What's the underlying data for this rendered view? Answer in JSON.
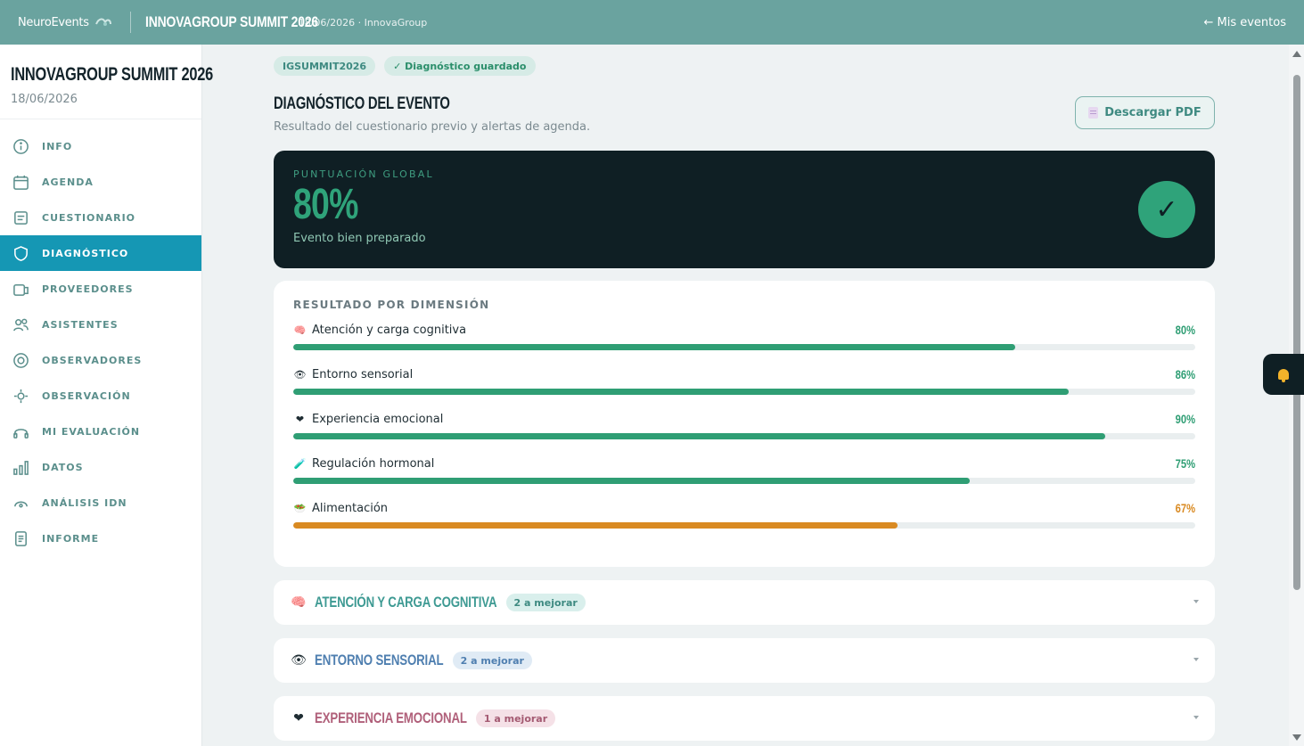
{
  "topbar": {
    "brand": "NeuroEvents",
    "event_title": "INNOVAGROUP SUMMIT 2026",
    "event_meta": "18/06/2026 · InnovaGroup",
    "back_link": "← Mis eventos"
  },
  "sidebar": {
    "title": "INNOVAGROUP SUMMIT 2026",
    "date": "18/06/2026",
    "items": [
      {
        "label": "INFO",
        "icon": "info-icon",
        "active": false
      },
      {
        "label": "AGENDA",
        "icon": "calendar-icon",
        "active": false
      },
      {
        "label": "CUESTIONARIO",
        "icon": "form-icon",
        "active": false
      },
      {
        "label": "DIAGNÓSTICO",
        "icon": "shield-icon",
        "active": true
      },
      {
        "label": "PROVEEDORES",
        "icon": "cards-icon",
        "active": false
      },
      {
        "label": "ASISTENTES",
        "icon": "users-icon",
        "active": false
      },
      {
        "label": "OBSERVADORES",
        "icon": "target-icon",
        "active": false
      },
      {
        "label": "OBSERVACIÓN",
        "icon": "crosshair-icon",
        "active": false
      },
      {
        "label": "MI EVALUACIÓN",
        "icon": "headphones-icon",
        "active": false
      },
      {
        "label": "DATOS",
        "icon": "bar-chart-icon",
        "active": false
      },
      {
        "label": "ANÁLISIS IDN",
        "icon": "gauge-icon",
        "active": false
      },
      {
        "label": "INFORME",
        "icon": "document-icon",
        "active": false
      }
    ]
  },
  "main": {
    "chips": [
      "IGSUMMIT2026",
      "✓ Diagnóstico guardado"
    ],
    "title": "DIAGNÓSTICO DEL EVENTO",
    "subtitle": "Resultado del cuestionario previo y alertas de agenda.",
    "pdf_button": "Descargar PDF",
    "score": {
      "label": "PUNTUACIÓN GLOBAL",
      "value": "80%",
      "description": "Evento bien preparado",
      "check": "✓"
    },
    "dimensions": {
      "heading": "RESULTADO POR DIMENSIÓN",
      "items": [
        {
          "name": "Atención y carga cognitiva",
          "emoji": "🧠",
          "pct_label": "80%",
          "value": 80,
          "color": "#2f9e74"
        },
        {
          "name": "Entorno sensorial",
          "emoji": "👁",
          "pct_label": "86%",
          "value": 86,
          "color": "#2f9e74"
        },
        {
          "name": "Experiencia emocional",
          "emoji": "❤",
          "pct_label": "90%",
          "value": 90,
          "color": "#2f9e74"
        },
        {
          "name": "Regulación hormonal",
          "emoji": "🧪",
          "pct_label": "75%",
          "value": 75,
          "color": "#2f9e74"
        },
        {
          "name": "Alimentación",
          "emoji": "🥗",
          "pct_label": "67%",
          "value": 67,
          "color": "#d98a22"
        }
      ]
    },
    "accordions": [
      {
        "title": "ATENCIÓN Y CARGA COGNITIVA",
        "emoji": "🧠",
        "badge": "2 a mejorar",
        "title_color": "#3e9a93",
        "badge_bg": "#d9efec",
        "badge_color": "#3e8a81"
      },
      {
        "title": "ENTORNO SENSORIAL",
        "emoji": "👁",
        "badge": "2 a mejorar",
        "title_color": "#4f7fb0",
        "badge_bg": "#e0ebf5",
        "badge_color": "#4f7fb0"
      },
      {
        "title": "EXPERIENCIA EMOCIONAL",
        "emoji": "❤",
        "badge": "1 a mejorar",
        "title_color": "#b0607a",
        "badge_bg": "#f5e1e7",
        "badge_color": "#a45a72"
      }
    ]
  },
  "notifications": {
    "icon": "bell-icon"
  }
}
